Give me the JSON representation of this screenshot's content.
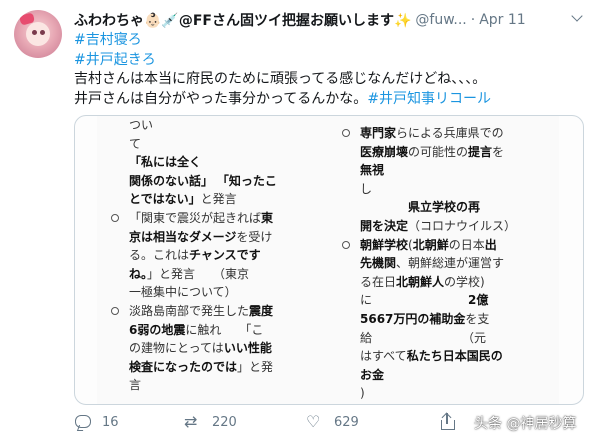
{
  "tweet": {
    "display_name": "ふわわちゃ👶🏻💉@FFさん固ツイ把握お願いします✨",
    "handle": "@fuw...",
    "separator": "·",
    "date": "Apr 11",
    "lines": [
      {
        "hashtag": "#吉村寝ろ"
      },
      {
        "hashtag": "#井戸起きろ"
      },
      {
        "text": "吉村さんは本当に府民のために頑張ってる感じなんだけどね、、、。"
      },
      {
        "text": "井戸さんは自分がやった事分かってるんかな。",
        "hashtag": "#井戸知事リコール"
      }
    ]
  },
  "image_card": {
    "left": [
      {
        "kind": "text",
        "t": "つい"
      },
      {
        "kind": "text",
        "t": "て"
      },
      {
        "kind": "bold",
        "t": "「私には全く"
      },
      {
        "kind": "mix",
        "parts": [
          {
            "b": "関係のない話」"
          },
          {
            "n": " "
          },
          {
            "b": "「知ったこ"
          }
        ]
      },
      {
        "kind": "mix",
        "parts": [
          {
            "b": "とではない」"
          },
          {
            "n": "と発言"
          }
        ]
      },
      {
        "kind": "mix",
        "bullet": true,
        "parts": [
          {
            "n": "「関東で震災が起きれば"
          },
          {
            "b": "東"
          }
        ]
      },
      {
        "kind": "mix",
        "parts": [
          {
            "b": "京は相当なダメージ"
          },
          {
            "n": "を受け"
          }
        ]
      },
      {
        "kind": "mix",
        "parts": [
          {
            "n": "る。これは"
          },
          {
            "b": "チャンスです"
          }
        ]
      },
      {
        "kind": "mix",
        "parts": [
          {
            "b": "ね。"
          },
          {
            "n": "」と発言　　（東京"
          }
        ]
      },
      {
        "kind": "text",
        "t": "一極集中について）"
      },
      {
        "kind": "mix",
        "bullet": true,
        "parts": [
          {
            "n": "淡路島南部で発生した"
          },
          {
            "b": "震度"
          }
        ]
      },
      {
        "kind": "mix",
        "parts": [
          {
            "b": "6弱の地震"
          },
          {
            "n": "に触れ　　「こ"
          }
        ]
      },
      {
        "kind": "mix",
        "parts": [
          {
            "n": "の建物にとっては"
          },
          {
            "b": "いい性能"
          }
        ]
      },
      {
        "kind": "mix",
        "parts": [
          {
            "b": "検査になったのでは"
          },
          {
            "n": "」と発"
          }
        ]
      },
      {
        "kind": "text",
        "t": "言"
      }
    ],
    "right": [
      {
        "kind": "mix",
        "bullet": true,
        "parts": [
          {
            "b": "専門家"
          },
          {
            "n": "らによる兵庫県での"
          }
        ]
      },
      {
        "kind": "mix",
        "parts": [
          {
            "b": "医療崩壊"
          },
          {
            "n": "の可能性の"
          },
          {
            "b": "提言"
          },
          {
            "n": "を"
          }
        ]
      },
      {
        "kind": "bold",
        "t": "無視"
      },
      {
        "kind": "text",
        "t": "し"
      },
      {
        "kind": "bold",
        "t": "　　　　県立学校の再"
      },
      {
        "kind": "mix",
        "parts": [
          {
            "b": "開を決定"
          },
          {
            "n": "（コロナウイルス）"
          }
        ]
      },
      {
        "kind": "mix",
        "bullet": true,
        "parts": [
          {
            "b": "朝鮮学校"
          },
          {
            "n": "("
          },
          {
            "b": "北朝鮮"
          },
          {
            "n": "の日本"
          },
          {
            "b": "出"
          }
        ]
      },
      {
        "kind": "mix",
        "parts": [
          {
            "b": "先機関"
          },
          {
            "n": "、朝鮮総連が運営す"
          }
        ]
      },
      {
        "kind": "mix",
        "parts": [
          {
            "n": "る在日"
          },
          {
            "b": "北朝鮮人"
          },
          {
            "n": "の学校)"
          }
        ]
      },
      {
        "kind": "mix",
        "parts": [
          {
            "n": "に　　　　　　　　"
          },
          {
            "b": "2億"
          }
        ]
      },
      {
        "kind": "mix",
        "parts": [
          {
            "b": "5667万円の補助金"
          },
          {
            "n": "を支"
          }
        ]
      },
      {
        "kind": "text",
        "t": "給　　　　　　　　（元"
      },
      {
        "kind": "mix",
        "parts": [
          {
            "n": "はすべて"
          },
          {
            "b": "私たち日本国民の"
          }
        ]
      },
      {
        "kind": "bold",
        "t": "お金"
      },
      {
        "kind": "text",
        "t": ")"
      }
    ]
  },
  "actions": {
    "replies": "16",
    "retweets": "220",
    "likes": "629"
  },
  "icons": {
    "reply": "reply-icon",
    "retweet": "retweet-icon",
    "like": "heart-icon",
    "share": "share-icon",
    "menu": "chevron-down-icon"
  },
  "watermark": "头条 @神居秒算",
  "colors": {
    "hashtag": "#1b95e0",
    "muted": "#657786",
    "text": "#14171a"
  }
}
